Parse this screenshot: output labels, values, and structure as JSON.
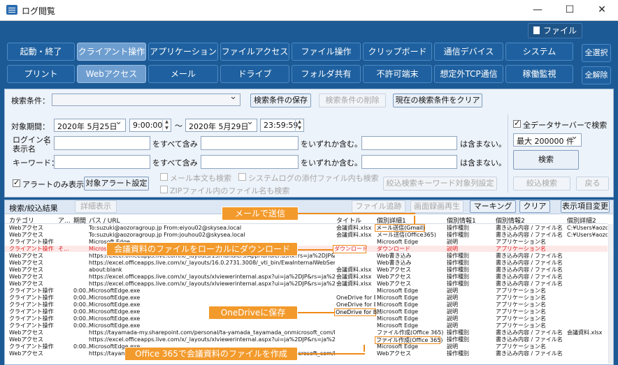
{
  "window": {
    "title": "ログ閲覧",
    "min": "—",
    "max": "☐",
    "close": "✕"
  },
  "file_button": "ファイル",
  "categories_row1": [
    "起動・終了",
    "クライアント操作",
    "アプリケーション",
    "ファイルアクセス",
    "ファイル操作",
    "クリップボード",
    "通信デバイス",
    "システム"
  ],
  "categories_row2": [
    "プリント",
    "Webアクセス",
    "メール",
    "ドライブ",
    "フォルダ共有",
    "不許可端末",
    "想定外TCP通信",
    "稼働監視"
  ],
  "select_all": "全選択",
  "deselect_all": "全解除",
  "conditions": {
    "search_condition_label": "検索条件：",
    "save_btn": "検索条件の保存",
    "delete_btn": "検索条件の削除",
    "clear_btn": "現在の検索条件をクリア",
    "period_label": "対象期間：",
    "date_from": "2020年  5月25日",
    "time_from": "9:00:00",
    "tilde": "～",
    "date_to": "2020年  5月29日",
    "time_to": "23:59:59",
    "login_label1": "ログイン名",
    "login_label2": "表示名",
    "keyword_label": "キーワード：",
    "all_include": "をすべて含み",
    "any_include": "をいずれか含む。",
    "not_include": "は含まない。",
    "all_include2": "をすべて含み",
    "any_include2": "をいずれか含む。",
    "not_include2": "は含まない。",
    "mail_body": "メール本文も検索",
    "syslog_attach": "システムログの添付ファイル内も検索",
    "zip_search": "ZIPファイル内のファイル名も検索",
    "alert_only": "アラートのみ表示:",
    "alert_setting_btn": "対象アラート設定",
    "refine_keyword_btn": "絞込検索キーワード対象列設定",
    "all_servers": "全データサーバーで検索",
    "max_count": "最大 200000 件",
    "search_btn": "検索",
    "refine_btn": "絞込検索",
    "back_btn": "戻る"
  },
  "results": {
    "title": "検索/絞込結果",
    "detail_btn": "詳細表示",
    "file_trace_btn": "ファイル追跡",
    "screen_rec_btn": "画面録画再生",
    "marking_btn": "マーキング",
    "clear_btn": "クリア",
    "column_change_btn": "表示項目変更",
    "columns": [
      "カテゴリ",
      "ア...",
      "期間",
      "パス / URL",
      "タイトル",
      "個別詳細1",
      "個別情報1",
      "個別情報2",
      "個別詳細2"
    ],
    "rows": [
      {
        "cat": "Webアクセス",
        "a": "",
        "t": "",
        "path": "To:suzuki@aozoragroup.jp From:eiyou02@skysea.local",
        "title": "会議資料.xlsx",
        "d1": "メール送信(Gmail)",
        "i1": "操作種別",
        "i2": "書き込み内容 / ファイル名",
        "d2": "C:¥Users¥aozo",
        "red": false
      },
      {
        "cat": "Webアクセス",
        "a": "",
        "t": "",
        "path": "To:suzuki@aozoragroup.jp From:jouhou02@skysea.local",
        "title": "会議資料.xlsx",
        "d1": "メール送信(Office365)",
        "i1": "操作種別",
        "i2": "書き込み内容 / ファイル名",
        "d2": "C:¥Users¥aozo",
        "red": false
      },
      {
        "cat": "クライアント操作",
        "a": "",
        "t": "",
        "path": "Microsoft Edge",
        "title": "",
        "d1": "Microsoft Edge",
        "i1": "説明",
        "i2": "アプリケーション名",
        "d2": "",
        "red": false
      },
      {
        "cat": "クライアント操作",
        "a": "そ...",
        "t": "",
        "path": "Microsoft Edge",
        "title": "",
        "d1": "ダウンロード",
        "i1": "説明",
        "i2": "アプリケーション名",
        "d2": "",
        "red": true
      },
      {
        "cat": "Webアクセス",
        "a": "",
        "t": "",
        "path": "https://excel.officeapps.live.com/x/_layouts/15/Handlers/AppHandler.ashx?rs=ja%2DJP&...",
        "title": "",
        "d1": "Web書き込み",
        "i1": "操作種別",
        "i2": "書き込み内容 / ファイル名",
        "d2": "",
        "red": false
      },
      {
        "cat": "Webアクセス",
        "a": "",
        "t": "",
        "path": "https://excel.officeapps.live.com/x/_layouts/16.0.2731.3008/_vti_bin/EwaInternalWebService.json/PingWFE",
        "title": "",
        "d1": "Web書き込み",
        "i1": "操作種別",
        "i2": "書き込み内容 / ファイル名",
        "d2": "",
        "red": false
      },
      {
        "cat": "Webアクセス",
        "a": "",
        "t": "",
        "path": "about:blank",
        "title": "会議資料.xlsx",
        "d1": "Webアクセス",
        "i1": "操作種別",
        "i2": "書き込み内容 / ファイル名",
        "d2": "",
        "red": false
      },
      {
        "cat": "Webアクセス",
        "a": "",
        "t": "",
        "path": "https://excel.officeapps.live.com/x/_layouts/xlviewerinternal.aspx?ui=ja%2DJP&rs=ja%2DJP&WOPISrc=...",
        "title": "会議資料.xlsx",
        "d1": "Webアクセス",
        "i1": "操作種別",
        "i2": "書き込み内容 / ファイル名",
        "d2": "",
        "red": false
      },
      {
        "cat": "Webアクセス",
        "a": "",
        "t": "",
        "path": "https://excel.officeapps.live.com/x/_layouts/xlviewerinternal.aspx?ui=ja%2DJP&rs=ja%2DJP&WOPISrc=...",
        "title": "会議資料.xlsx",
        "d1": "Webアクセス",
        "i1": "操作種別",
        "i2": "書き込み内容 / ファイル名",
        "d2": "",
        "red": false
      },
      {
        "cat": "クライアント操作",
        "a": "",
        "t": "0:00...",
        "path": "MicrosoftEdge.exe",
        "title": "",
        "d1": "Microsoft Edge",
        "i1": "説明",
        "i2": "アプリケーション名",
        "d2": "",
        "red": false
      },
      {
        "cat": "クライアント操作",
        "a": "",
        "t": "0:00...",
        "path": "MicrosoftEdge.exe",
        "title": "OneDrive for B...",
        "d1": "Microsoft Edge",
        "i1": "説明",
        "i2": "アプリケーション名",
        "d2": "",
        "red": false
      },
      {
        "cat": "クライアント操作",
        "a": "",
        "t": "0:00...",
        "path": "MicrosoftEdge.exe",
        "title": "OneDrive for B...",
        "d1": "Microsoft Edge",
        "i1": "説明",
        "i2": "アプリケーション名",
        "d2": "",
        "red": false
      },
      {
        "cat": "クライアント操作",
        "a": "",
        "t": "0:00...",
        "path": "MicrosoftEdge.exe",
        "title": "OneDrive for B...",
        "d1": "Microsoft Edge",
        "i1": "説明",
        "i2": "アプリケーション名",
        "d2": "",
        "red": false
      },
      {
        "cat": "クライアント操作",
        "a": "",
        "t": "0:00...",
        "path": "MicrosoftEdge.exe",
        "title": "",
        "d1": "Microsoft Edge",
        "i1": "説明",
        "i2": "アプリケーション名",
        "d2": "",
        "red": false
      },
      {
        "cat": "クライアント操作",
        "a": "",
        "t": "0:00...",
        "path": "MicrosoftEdge.exe",
        "title": "",
        "d1": "Microsoft Edge",
        "i1": "説明",
        "i2": "アプリケーション名",
        "d2": "",
        "red": false
      },
      {
        "cat": "Webアクセス",
        "a": "",
        "t": "",
        "path": "https://tayamada-my.sharepoint.com/personal/ta-yamada_tayamada_onmicrosoft_com/Documents...",
        "title": "",
        "d1": "ファイル作成(Office 365)",
        "i1": "操作種別",
        "i2": "書き込み内容 / ファイル名",
        "d2": "会議資料.xlsx",
        "red": false
      },
      {
        "cat": "Webアクセス",
        "a": "",
        "t": "",
        "path": "https://excel.officeapps.live.com/x/_layouts/xlviewerinternal.aspx?ui=ja%2DJP&rs=ja%2DJP&WOPISrc=...",
        "title": "",
        "d1": "Webアクセス",
        "i1": "操作種別",
        "i2": "書き込み内容 / ファイル名",
        "d2": "",
        "red": false
      },
      {
        "cat": "クライアント操作",
        "a": "",
        "t": "0:00...",
        "path": "MicrosoftEdge.exe",
        "title": "",
        "d1": "Microsoft Edge",
        "i1": "説明",
        "i2": "アプリケーション名",
        "d2": "",
        "red": false
      },
      {
        "cat": "Webアクセス",
        "a": "",
        "t": "",
        "path": "https://tayamada-my.sharepoint.com/personal/ta-yamada_tayamada_onmicrosoft_com/Documents...",
        "title": "",
        "d1": "Webアクセス",
        "i1": "操作種別",
        "i2": "書き込み内容 / ファイル名",
        "d2": "",
        "red": false
      }
    ]
  },
  "callouts": {
    "mail": "メールで送信",
    "download": "会議資料のファイルをローカルにダウンロード",
    "onedrive": "OneDriveに保存",
    "office365": "Office 365で会議資料のファイルを作成"
  },
  "highlight_texts": {
    "mail_gmail": "メール送信(Gmail)",
    "download": "ダウンロード",
    "onedrive": "OneDrive for B...",
    "file_create": "ファイル作成(Office 365)"
  },
  "colors": {
    "accent": "#1c5a96",
    "callout": "#f39a2c",
    "alert_red": "#e02020"
  }
}
